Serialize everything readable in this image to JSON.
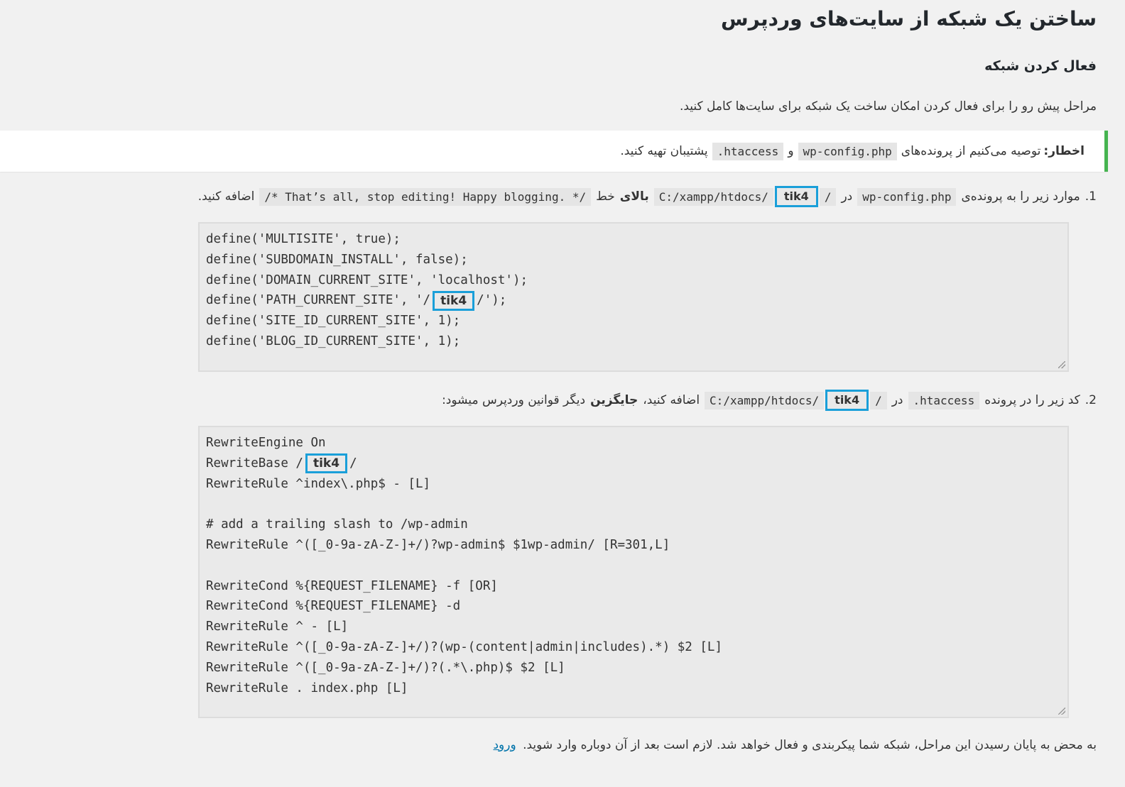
{
  "header": {
    "title": "ساختن یک شبکه از سایت‌های وردپرس",
    "section_title": "فعال کردن شبکه",
    "intro": "مراحل پیش رو را برای فعال کردن امکان ساخت یک شبکه برای سایت‌ها کامل کنید."
  },
  "notice": {
    "label": "اخطار:",
    "text1": "توصیه می‌کنیم از پرونده‌های",
    "file1": "wp-config.php",
    "and": "و",
    "file2": ".htaccess",
    "text2": "پشتیبان تهیه کنید.",
    "accent_color": "#46b450"
  },
  "highlight": {
    "text": "tik4",
    "color": "#1a9fd9"
  },
  "step1": {
    "number": "1.",
    "text1": "موارد زیر را به پرونده‌ی",
    "file": "wp-config.php",
    "in": "در",
    "path_prefix": "C:/xampp/htdocs/",
    "path_suffix": "/",
    "above": "بالای",
    "line_word": "خط",
    "stop_line": "/* That’s all, stop editing! Happy blogging. */",
    "text2": "اضافه کنید."
  },
  "code1": {
    "lines": [
      "define('MULTISITE', true);",
      "define('SUBDOMAIN_INSTALL', false);",
      "define('DOMAIN_CURRENT_SITE', 'localhost');",
      "define('PATH_CURRENT_SITE', '/",
      "/');",
      "define('SITE_ID_CURRENT_SITE', 1);",
      "define('BLOG_ID_CURRENT_SITE', 1);"
    ]
  },
  "step2": {
    "number": "2.",
    "text1": "کد زیر را در پرونده",
    "file": ".htaccess",
    "in": "در",
    "path_prefix": "C:/xampp/htdocs/",
    "path_suffix": "/",
    "text2": "اضافه کنید،",
    "replace": "جایگزین",
    "text3": "دیگر قوانین وردپرس میشود:"
  },
  "code2": {
    "lines": [
      "RewriteEngine On",
      "RewriteBase /",
      "/",
      "RewriteRule ^index\\.php$ - [L]",
      "",
      "# add a trailing slash to /wp-admin",
      "RewriteRule ^([_0-9a-zA-Z-]+/)?wp-admin$ $1wp-admin/ [R=301,L]",
      "",
      "RewriteCond %{REQUEST_FILENAME} -f [OR]",
      "RewriteCond %{REQUEST_FILENAME} -d",
      "RewriteRule ^ - [L]",
      "RewriteRule ^([_0-9a-zA-Z-]+/)?(wp-(content|admin|includes).*) $2 [L]",
      "RewriteRule ^([_0-9a-zA-Z-]+/)?(.*\\.php)$ $2 [L]",
      "RewriteRule . index.php [L]"
    ]
  },
  "footer": {
    "text": "به محض به پایان رسیدن این مراحل، شبکه شما پیکربندی و فعال خواهد شد. لازم است بعد از آن دوباره وارد شوید.",
    "login_link": "ورود"
  }
}
